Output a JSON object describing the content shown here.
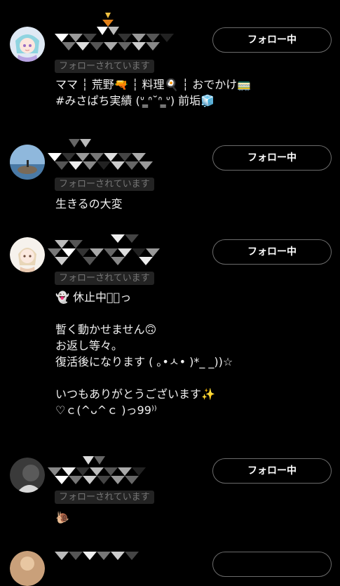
{
  "users": [
    {
      "follows_you_label": "フォローされています",
      "follow_button_label": "フォロー中",
      "bio_lines": [
        "ママ ┆ 荒野🔫 ┆ 料理🍳 ┆ おでかけ🚃",
        "#みさぱち実績 (ᐡ ̳ᐢ˘ᐢ ̳ᐡ) 前垢🧊"
      ]
    },
    {
      "follows_you_label": "フォローされています",
      "follow_button_label": "フォロー中",
      "bio_lines": [
        "生きるの大変"
      ]
    },
    {
      "follows_you_label": "フォローされています",
      "follow_button_label": "フォロー中",
      "bio_lines": [
        "👻 休止中っ͛っ",
        "",
        "暫く動かせません🙃",
        "お返し等々｡",
        "復活後になります ( ｡•ㅅ• )*_ _))☆",
        "",
        "いつもありがとうございます✨",
        "♡ｃ(^ᴗ^ｃ )っ99⁾⁾"
      ]
    },
    {
      "follows_you_label": "フォローされています",
      "follow_button_label": "フォロー中",
      "bio_lines": [
        "🐌"
      ]
    },
    {
      "follows_you_label": "",
      "follow_button_label": "",
      "bio_lines": []
    }
  ],
  "colors": {
    "background": "#000000",
    "text": "#f0f0f0",
    "button_border": "#6b6b6b",
    "badge_bg": "#2a2a2a",
    "badge_text": "#8a8a8a"
  }
}
